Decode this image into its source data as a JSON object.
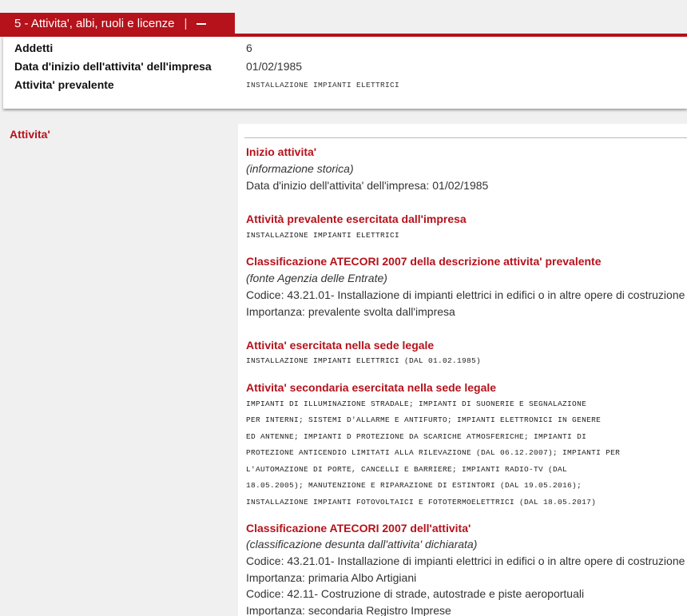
{
  "section": {
    "title": "5 - Attivita', albi, ruoli e licenze",
    "separator": "|"
  },
  "summary": {
    "addetti_label": "Addetti",
    "addetti_value": "6",
    "data_inizio_label": "Data d'inizio dell'attivita' dell'impresa",
    "data_inizio_value": "01/02/1985",
    "prevalente_label": "Attivita' prevalente",
    "prevalente_value": "INSTALLAZIONE IMPIANTI ELETTRICI"
  },
  "left_label": "Attivita'",
  "blocks": {
    "inizio": {
      "title": "Inizio attivita'",
      "note": "(informazione storica)",
      "text": "Data d'inizio dell'attivita' dell'impresa: 01/02/1985"
    },
    "prevalente": {
      "title": "Attività prevalente esercitata dall'impresa",
      "text": "INSTALLAZIONE IMPIANTI ELETTRICI"
    },
    "ateco_prevalente": {
      "title": "Classificazione ATECORI 2007 della descrizione attivita' prevalente",
      "note": "(fonte Agenzia delle Entrate)",
      "codice": "Codice: 43.21.01- Installazione di impianti elettrici in edifici o in altre opere di costruzione",
      "importanza": "Importanza: prevalente svolta dall'impresa"
    },
    "sede_legale": {
      "title": "Attivita' esercitata nella sede legale",
      "text": "INSTALLAZIONE IMPIANTI ELETTRICI (DAL 01.02.1985)"
    },
    "secondaria": {
      "title": "Attivita' secondaria esercitata nella sede legale",
      "lines": [
        "IMPIANTI DI ILLUMINAZIONE STRADALE; IMPIANTI DI SUONERIE E SEGNALAZIONE",
        "PER INTERNI; SISTEMI D'ALLARME E ANTIFURTO; IMPIANTI ELETTRONICI IN GENERE",
        "ED ANTENNE; IMPIANTI D PROTEZIONE DA SCARICHE ATMOSFERICHE; IMPIANTI DI",
        "PROTEZIONE ANTICENDIO LIMITATI ALLA RILEVAZIONE (DAL 06.12.2007); IMPIANTI PER",
        "L'AUTOMAZIONE DI PORTE, CANCELLI E BARRIERE; IMPIANTI RADIO-TV (DAL",
        "18.05.2005); MANUTENZIONE E RIPARAZIONE DI ESTINTORI (DAL 19.05.2016);",
        "INSTALLAZIONE IMPIANTI FOTOVOLTAICI E FOTOTERMOELETTRICI (DAL 18.05.2017)"
      ]
    },
    "ateco_attivita": {
      "title": "Classificazione ATECORI 2007 dell'attivita'",
      "note": "(classificazione desunta dall'attivita' dichiarata)",
      "codice1": "Codice: 43.21.01- Installazione di impianti elettrici in edifici o in altre opere di costruzione",
      "importanza1": "Importanza: primaria Albo Artigiani",
      "codice2": "Codice: 42.11- Costruzione di strade, autostrade e piste aeroportuali",
      "importanza2": "Importanza: secondaria Registro Imprese"
    }
  },
  "colors": {
    "accent": "#b5121b",
    "background": "#f0f0f0",
    "panel": "#ffffff"
  }
}
